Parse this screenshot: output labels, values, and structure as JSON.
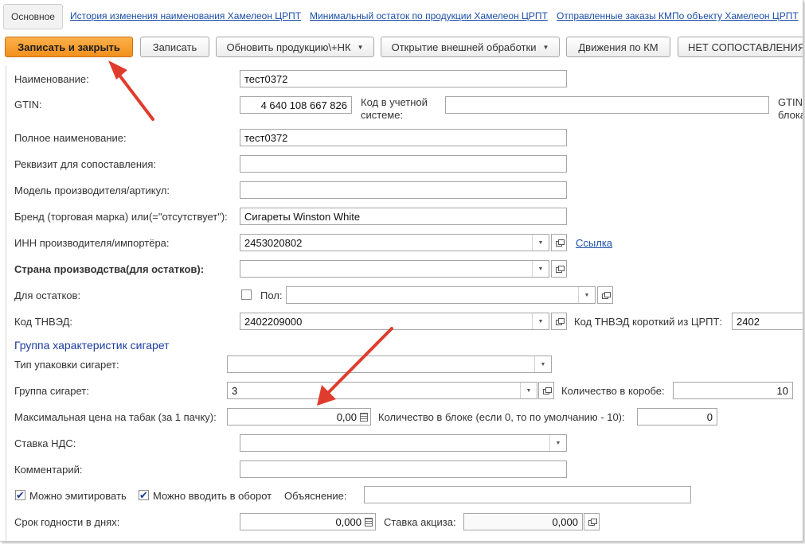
{
  "tabs": {
    "active": "Основное",
    "links": [
      "История изменения наименования Хамелеон ЦРПТ",
      "Минимальный остаток по продукции Хамелеон ЦРПТ",
      "Отправленные заказы КМПо объекту Хамелеон ЦРПТ"
    ]
  },
  "toolbar": {
    "save_close": "Записать и закрыть",
    "save": "Записать",
    "update_products": "Обновить продукцию\\+НК",
    "open_external": "Открытие внешней обработки",
    "movements_km": "Движения по КМ",
    "no_match": "НЕТ СОПОСТАВЛЕНИЯ"
  },
  "form": {
    "name": {
      "label": "Наименование:",
      "value": "тест0372"
    },
    "gtin": {
      "label": "GTIN:",
      "value": "4 640 108 667 826"
    },
    "account_code": {
      "label": "Код в учетной системе:",
      "value": ""
    },
    "gtin_block": {
      "label": "GTIN блока"
    },
    "full_name": {
      "label": "Полное наименование:",
      "value": "тест0372"
    },
    "match_attr": {
      "label": "Реквизит для сопоставления:",
      "value": ""
    },
    "model": {
      "label": "Модель производителя/артикул:",
      "value": ""
    },
    "brand": {
      "label": "Бренд (торговая марка) или(=\"отсутствует\"):",
      "value": "Сигареты Winston White"
    },
    "inn": {
      "label": "ИНН производителя/импортёра:",
      "value": "2453020802",
      "link": "Ссылка"
    },
    "country": {
      "label": "Страна производства(для остатков):",
      "value": ""
    },
    "for_remains": {
      "label": "Для остатков:",
      "gender_label": "Пол:",
      "gender_value": ""
    },
    "tnved": {
      "label": "Код ТНВЭД:",
      "value": "2402209000",
      "short_label": "Код ТНВЭД короткий из ЦРПТ:",
      "short_value": "2402"
    },
    "group_title": "Группа  характеристик сигарет",
    "pack_type": {
      "label": "Тип упаковки сигарет:",
      "value": ""
    },
    "cig_group": {
      "label": "Группа сигарет:",
      "value": "3",
      "box_qty_label": "Количество в коробе:",
      "box_qty": "10"
    },
    "max_price": {
      "label": "Максимальная цена на табак (за 1 пачку):",
      "value": "0,00",
      "block_qty_label": "Количество в блоке (если 0, то по умолчанию - 10):",
      "block_qty": "0"
    },
    "vat": {
      "label": "Ставка НДС:",
      "value": ""
    },
    "comment": {
      "label": "Комментарий:",
      "value": ""
    },
    "can_emit": {
      "label": "Можно эмитировать",
      "checked": true
    },
    "can_circulate": {
      "label": "Можно вводить в оборот",
      "checked": true
    },
    "explanation": {
      "label": "Объяснение:",
      "value": ""
    },
    "shelf_life": {
      "label": "Срок годности в днях:",
      "value": "0,000",
      "excise_label": "Ставка акциза:",
      "excise_value": "0,000"
    }
  },
  "colors": {
    "accent": "#f2901c",
    "link": "#1c4fa8",
    "annotation_arrow": "#e03c2e"
  },
  "check_mark": "✔"
}
